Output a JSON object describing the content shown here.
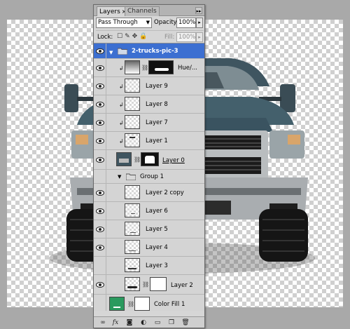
{
  "panel": {
    "tabs": [
      {
        "label": "Layers",
        "close": "×"
      },
      {
        "label": "Channels"
      }
    ],
    "menu_arrows": "▸▸"
  },
  "blend": {
    "mode": "Pass Through",
    "opacity_label": "Opacity:",
    "opacity_value": "100%",
    "lock_label": "Lock:",
    "fill_label": "Fill:",
    "fill_value": "100%"
  },
  "layers": [
    {
      "name": "2-trucks-pic-3",
      "type": "group",
      "expanded": true,
      "selected": true,
      "visible": true
    },
    {
      "name": "Hue/...",
      "type": "adjustment",
      "clipped": true,
      "visible": true
    },
    {
      "name": "Layer 9",
      "type": "layer",
      "clipped": true,
      "visible": true
    },
    {
      "name": "Layer 8",
      "type": "layer",
      "clipped": true,
      "visible": true
    },
    {
      "name": "Layer 7",
      "type": "layer",
      "clipped": true,
      "visible": true
    },
    {
      "name": "Layer 1",
      "type": "layer",
      "clipped": true,
      "visible": true
    },
    {
      "name": "Layer 0",
      "type": "masked",
      "visible": true
    },
    {
      "name": "Group 1",
      "type": "group",
      "expanded": true,
      "visible": false
    },
    {
      "name": "Layer 2 copy",
      "type": "layer",
      "visible": true
    },
    {
      "name": "Layer 6",
      "type": "layer",
      "visible": true
    },
    {
      "name": "Layer 5",
      "type": "layer",
      "visible": true
    },
    {
      "name": "Layer 4",
      "type": "layer",
      "visible": true
    },
    {
      "name": "Layer 3",
      "type": "layer",
      "visible": false
    },
    {
      "name": "Layer 2",
      "type": "masked",
      "visible": true
    },
    {
      "name": "Color Fill 1",
      "type": "fill",
      "visible": false
    }
  ],
  "bottom_icons": [
    "link-icon",
    "fx-icon",
    "mask-icon",
    "adjustment-icon",
    "folder-icon",
    "new-layer-icon",
    "trash-icon"
  ],
  "colors": {
    "selection": "#3c6fd1",
    "fill_swatch": "#2a9a5e",
    "truck_body": "#3f5560"
  }
}
